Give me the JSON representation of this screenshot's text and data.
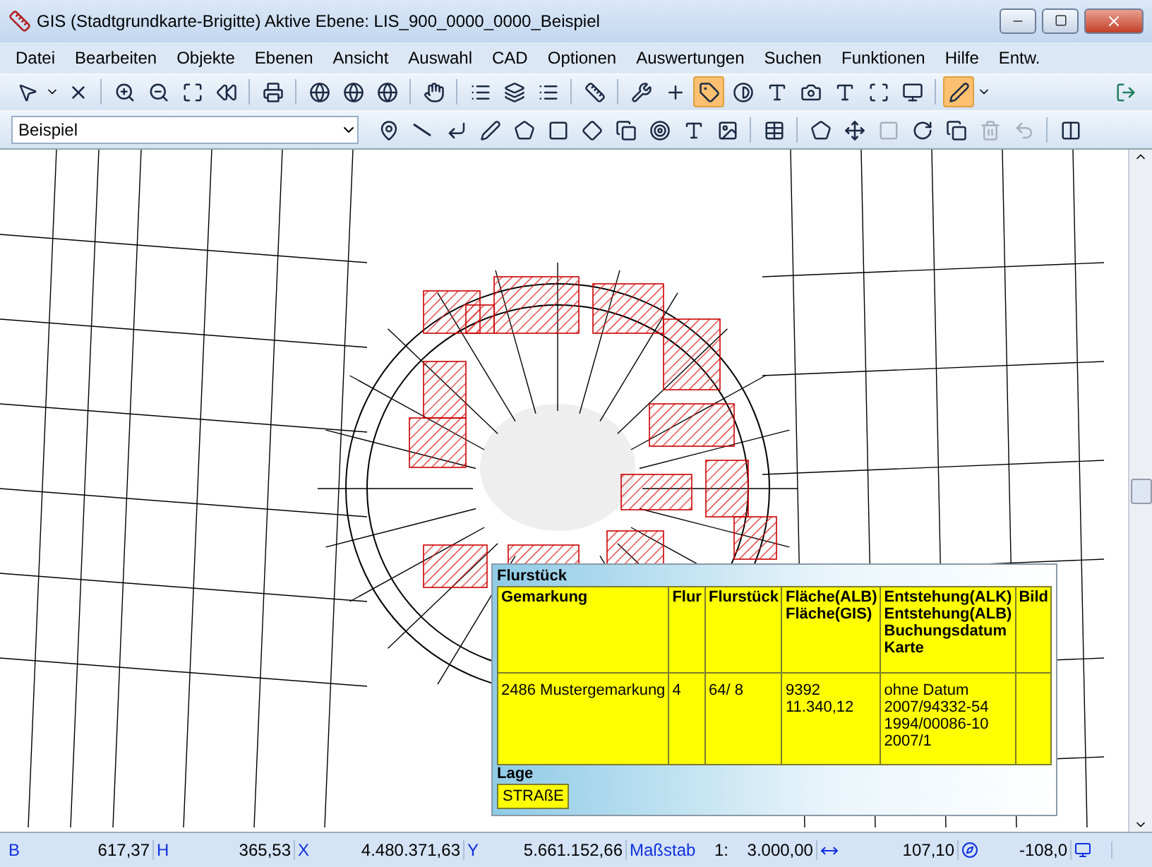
{
  "window": {
    "title": "GIS (Stadtgrundkarte-Brigitte) Aktive Ebene: LIS_900_0000_0000_Beispiel"
  },
  "menu": [
    "Datei",
    "Bearbeiten",
    "Objekte",
    "Ebenen",
    "Ansicht",
    "Auswahl",
    "CAD",
    "Optionen",
    "Auswertungen",
    "Suchen",
    "Funktionen",
    "Hilfe",
    "Entw."
  ],
  "toolbar_1": [
    {
      "active": false
    },
    {
      "active": false
    },
    {
      "active": false
    },
    {
      "active": false
    },
    {
      "active": false
    },
    {
      "active": false
    },
    {
      "active": false
    },
    {
      "active": false
    },
    {
      "active": false
    },
    {
      "active": false
    },
    {
      "active": false
    },
    {
      "active": false
    },
    {
      "active": false
    },
    {
      "active": false
    },
    {
      "active": false
    },
    {
      "active": false
    },
    {
      "active": false
    },
    {
      "active": true
    },
    {
      "active": false
    },
    {
      "active": false
    },
    {
      "active": false
    },
    {
      "active": false
    },
    {
      "active": false
    },
    {
      "active": false
    },
    {
      "active": true
    }
  ],
  "layer_select": {
    "value": "Beispiel"
  },
  "toolbar_2": [
    {
      "disabled": false
    },
    {
      "disabled": false
    },
    {
      "disabled": false
    },
    {
      "disabled": false
    },
    {
      "disabled": false
    },
    {
      "disabled": false
    },
    {
      "disabled": false
    },
    {
      "disabled": false
    },
    {
      "disabled": false
    },
    {
      "disabled": false
    },
    {
      "disabled": false
    },
    {
      "disabled": false
    },
    {
      "disabled": false
    },
    {
      "disabled": false
    },
    {
      "disabled": true
    },
    {
      "disabled": false
    },
    {
      "disabled": false
    },
    {
      "disabled": true
    },
    {
      "disabled": true
    }
  ],
  "popup": {
    "title": "Flurstück",
    "columns": [
      "Gemarkung",
      "Flur",
      "Flurstück",
      "Fläche(ALB)\nFläche(GIS)",
      "Entstehung(ALK)\nEntstehung(ALB)\nBuchungsdatum\nKarte",
      "Bild"
    ],
    "rows": [
      [
        "2486 Mustergemarkung",
        "4",
        "64/ 8",
        "9392\n11.340,12",
        "ohne Datum\n2007/94332-54\n1994/00086-10\n2007/1",
        ""
      ]
    ],
    "location_title": "Lage",
    "location": "STRAßE"
  },
  "status_bar": [
    {
      "kind": "value",
      "label": "B",
      "value": "617,37"
    },
    {
      "kind": "value",
      "label": "H",
      "value": "365,53"
    },
    {
      "kind": "value",
      "label": "X",
      "value": "4.480.371,63"
    },
    {
      "kind": "value",
      "label": "Y",
      "value": "5.661.152,66"
    },
    {
      "kind": "scale",
      "label": "Maßstab",
      "value": "1:",
      "extra": "3.000,00"
    },
    {
      "kind": "width",
      "value": "107,10"
    },
    {
      "kind": "angle",
      "value": "-108,0"
    },
    {
      "kind": "unit"
    }
  ]
}
